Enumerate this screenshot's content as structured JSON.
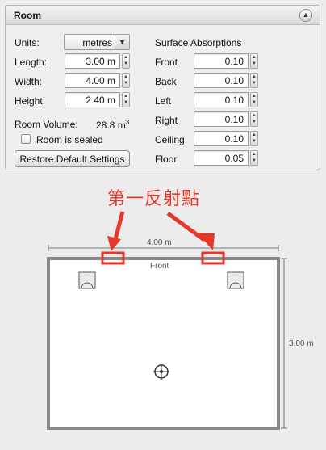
{
  "panel": {
    "title": "Room",
    "collapse_icon": "double-chevron-up-icon"
  },
  "room": {
    "units_label": "Units:",
    "units_value": "metres",
    "length_label": "Length:",
    "length_value": "3.00 m",
    "width_label": "Width:",
    "width_value": "4.00 m",
    "height_label": "Height:",
    "height_value": "2.40 m",
    "volume_label": "Room Volume:",
    "volume_value": "28.8 m",
    "volume_exp": "3",
    "sealed_label": "Room is sealed",
    "sealed_checked": false,
    "restore_label": "Restore Default Settings"
  },
  "absorptions": {
    "heading": "Surface Absorptions",
    "items": [
      {
        "label": "Front",
        "value": "0.10"
      },
      {
        "label": "Back",
        "value": "0.10"
      },
      {
        "label": "Left",
        "value": "0.10"
      },
      {
        "label": "Right",
        "value": "0.10"
      },
      {
        "label": "Ceiling",
        "value": "0.10"
      },
      {
        "label": "Floor",
        "value": "0.05"
      }
    ]
  },
  "annotation": {
    "text": "第一反射點",
    "color": "#e53829"
  },
  "plan": {
    "width_dim": "4.00 m",
    "depth_dim": "3.00 m",
    "wall_label": "Front"
  }
}
